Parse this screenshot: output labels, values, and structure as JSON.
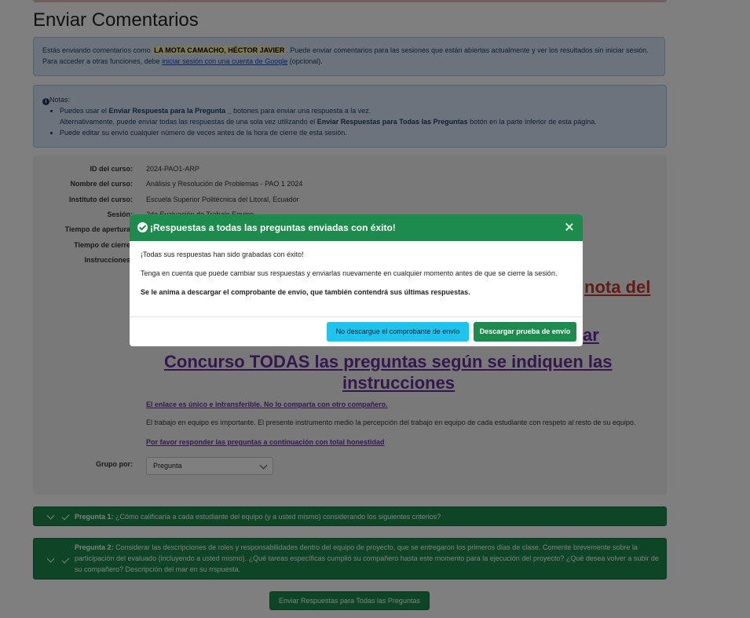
{
  "page": {
    "title": "Enviar Comentarios"
  },
  "info": {
    "prefix": "Estás enviando comentarios como ",
    "user": "LA MOTA CAMACHO, HÉCTOR JAVIER",
    "suffix": ". Puede enviar comentarios para las sesiones que están abiertas actualmente y ver los resultados sin iniciar sesión. Para acceder a otras funciones, debe ",
    "login_link": "iniciar sesión con una cuenta de Google",
    "tail": " (opcional)."
  },
  "notes": {
    "header": "Notas:",
    "item1_a": "Puedes usar el ",
    "item1_b": "Enviar Respuesta para la Pregunta _",
    "item1_c": " botones para enviar una respuesta a la vez.",
    "item1_d": "Alternativamente, puede enviar todas las respuestas de una sola vez utilizando el ",
    "item1_e": "Enviar Respuestas para Todas las Preguntas",
    "item1_f": " botón en la parte inferior de esta página.",
    "item2": "Puede editar su envío cualquier número de veces antes de la hora de cierre de esta sesión."
  },
  "details": {
    "course_id_label": "ID del curso:",
    "course_id": "2024-PAO1-ARP",
    "course_name_label": "Nombre del curso:",
    "course_name": "Análisis y Resolución de Problemas - PAO 1 2024",
    "institute_label": "Instituto del curso:",
    "institute": "Escuela Superior Politécnica del Litoral, Ecuador",
    "session_label": "Sesión:",
    "session": "2da Evaluación de Trabajo Equipo",
    "open_time_label": "Tiempo de apertura:",
    "close_time_label": "Tiempo de cierre:",
    "instructions_label": "Instrucciones:",
    "red_fragment": "nota del",
    "purple_fragment": "zar",
    "big_link_1": "Concurso TODAS las preguntas según se indiquen las",
    "big_link_2": "instrucciones",
    "link_unique": "El enlace es único e intransferible. No lo comparta con otro compañero.",
    "teamwork_text": "El trabajo en equipo es importante.  El presente instrumento medio la percepción del trabajo en equipo de cada estudiante con respeto al resto de su equipo.",
    "honesty_link": "Por favor responder las preguntas a continuación con total honestidad",
    "group_label": "Grupo por:",
    "group_value": "Pregunta"
  },
  "questions": [
    {
      "title": "Pregunta 1:",
      "text": " ¿Cómo calificaría a cada estudiante del equipo (y a usted mismo) considerando los siguientes criterios?"
    },
    {
      "title": "Pregunta 2:",
      "text": " Considerar las descripciones de roles y responsabilidades dentro del equipo de proyecto, que se entregaron los primeros días de clase. Comente brevemente sobre la participación del evaluado (incluyendo a usted mismo). ¿Qué tareas específicas cumplió su compañero hasta este momento para la ejecución del proyecto? ¿Qué desea volver a subir de su compañero? Descripción del mar en su rrspuesta."
    }
  ],
  "submit_all_label": "Enviar Respuestas para Todas las Preguntas",
  "modal": {
    "title": "¡Respuestas a todas las preguntas enviadas con éxito!",
    "line1": "¡Todas sus respuestas han sido grabadas con éxito!",
    "line2": "Tenga en cuenta que puede cambiar sus respuestas y enviarlas nuevamente en cualquier momento antes de que se cierre la sesión.",
    "line3": "Se le anima a descargar el comprobante de envío, que también contendrá sus últimas respuestas.",
    "btn_no": "No descargue el comprobante de envío",
    "btn_yes": "Descargar prueba de envío"
  },
  "colors": {
    "success_green": "#1e8b4e",
    "info_cyan": "#1ec4ed",
    "info_blue_bg": "#d9e7f8",
    "link_purple": "#6a2fa0",
    "link_red": "#c0392b"
  }
}
